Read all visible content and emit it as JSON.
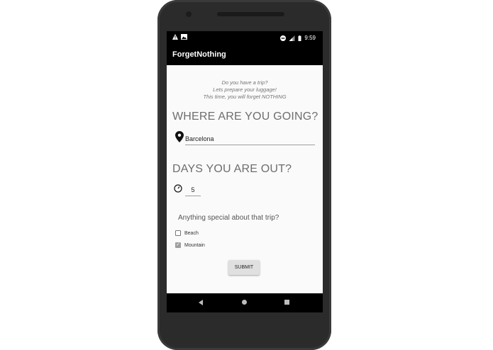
{
  "status_bar": {
    "time": "9:59",
    "icons": [
      "warning-icon",
      "image-icon",
      "dnd-icon",
      "signal-icon",
      "battery-icon"
    ]
  },
  "app": {
    "title": "ForgetNothing"
  },
  "intro": {
    "line1": "Do you have a trip?",
    "line2": "Lets prepare your luggage!",
    "line3": "This time, you will forget NOTHING"
  },
  "destination": {
    "heading": "WHERE ARE YOU GOING?",
    "value": "Barcelona"
  },
  "days": {
    "heading": "DAYS YOU ARE OUT?",
    "value": "5"
  },
  "special": {
    "question": "Anything special about that trip?",
    "options": [
      {
        "label": "Beach",
        "checked": false
      },
      {
        "label": "Mountain",
        "checked": true
      }
    ]
  },
  "submit_label": "SUBMIT",
  "colors": {
    "appbar": "#000000",
    "content_bg": "#fafafa",
    "heading": "#6e6e6e"
  }
}
